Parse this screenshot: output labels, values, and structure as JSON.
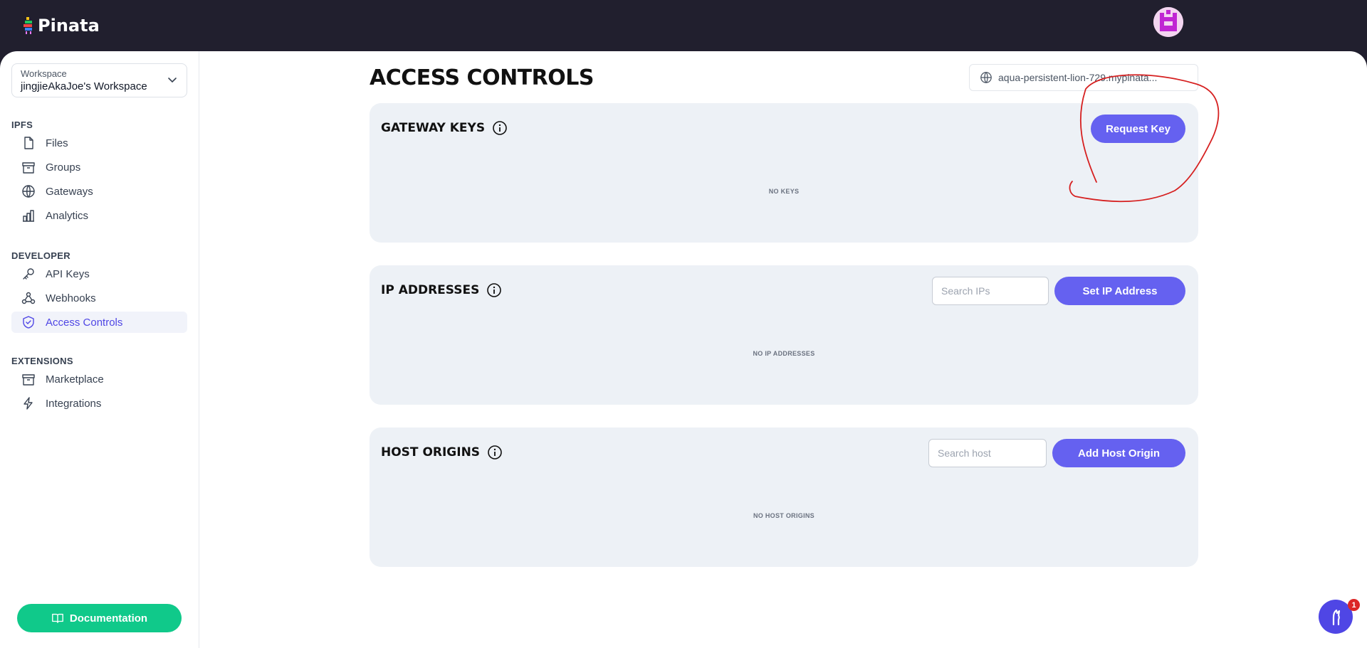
{
  "app": {
    "logo_text": "Pinata"
  },
  "sidebar": {
    "workspace_label": "Workspace",
    "workspace_name": "jingjieAkaJoe's Workspace",
    "sections": {
      "ipfs": "IPFS",
      "developer": "DEVELOPER",
      "extensions": "EXTENSIONS"
    },
    "items": [
      {
        "label": "Files",
        "icon": "file-icon"
      },
      {
        "label": "Groups",
        "icon": "archive-icon"
      },
      {
        "label": "Gateways",
        "icon": "globe-icon"
      },
      {
        "label": "Analytics",
        "icon": "bar-chart-icon"
      },
      {
        "label": "API Keys",
        "icon": "key-icon"
      },
      {
        "label": "Webhooks",
        "icon": "webhook-icon"
      },
      {
        "label": "Access Controls",
        "icon": "shield-icon",
        "active": true
      },
      {
        "label": "Marketplace",
        "icon": "archive-icon"
      },
      {
        "label": "Integrations",
        "icon": "lightning-icon"
      }
    ],
    "documentation_label": "Documentation"
  },
  "main": {
    "title": "ACCESS CONTROLS",
    "gateway_domain": "aqua-persistent-lion-729.mypinata...",
    "cards": {
      "gateway_keys": {
        "title": "GATEWAY KEYS",
        "button": "Request Key",
        "empty": "NO KEYS"
      },
      "ip_addresses": {
        "title": "IP ADDRESSES",
        "search_placeholder": "Search IPs",
        "button": "Set IP Address",
        "empty": "NO IP ADDRESSES"
      },
      "host_origins": {
        "title": "HOST ORIGINS",
        "search_placeholder": "Search host",
        "button": "Add Host Origin",
        "empty": "NO HOST ORIGINS"
      }
    }
  },
  "chat": {
    "badge_count": "1"
  },
  "colors": {
    "primary": "#6561f0",
    "green": "#10c98a",
    "dark": "#211f2e",
    "annotation": "#d62020"
  }
}
